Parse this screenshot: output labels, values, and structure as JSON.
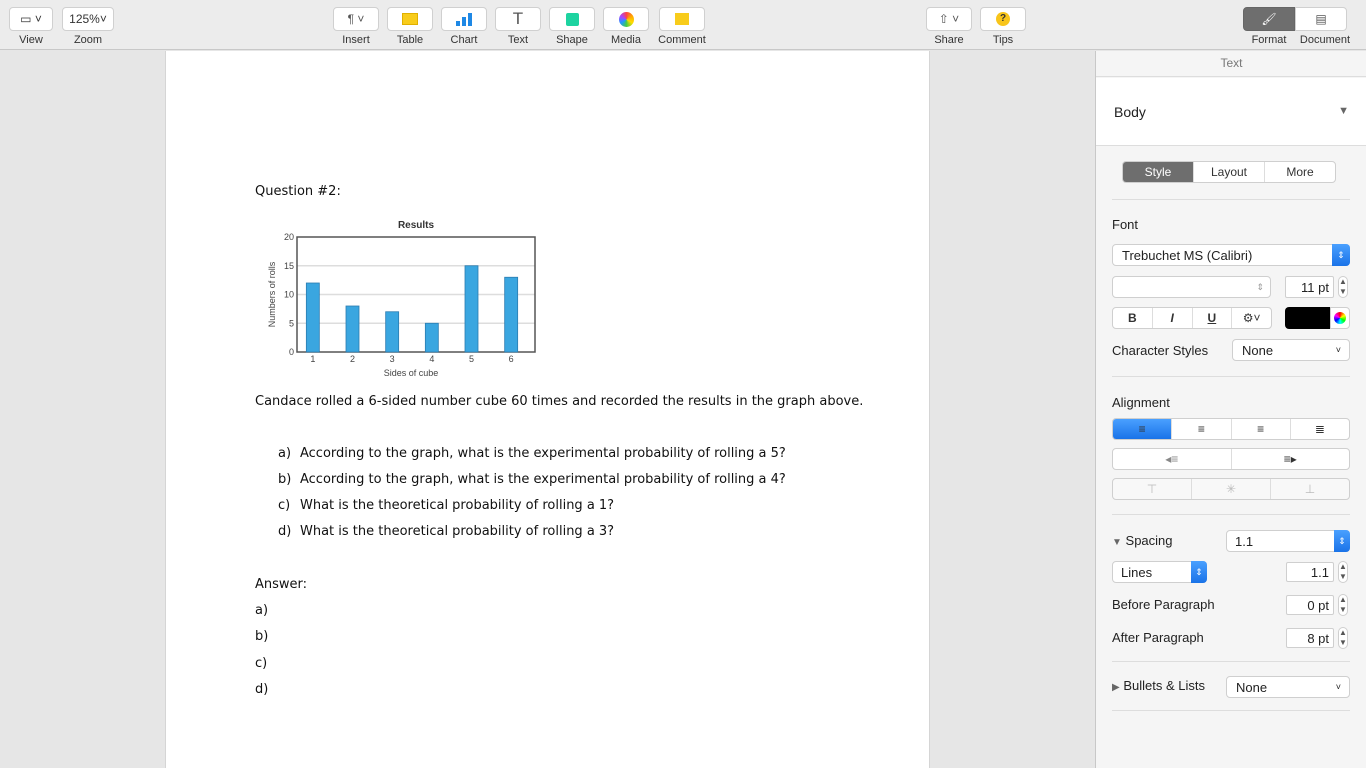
{
  "toolbar": {
    "view": "View",
    "zoom_value": "125%",
    "zoom": "Zoom",
    "insert": "Insert",
    "table": "Table",
    "chart": "Chart",
    "text": "Text",
    "shape": "Shape",
    "media": "Media",
    "comment": "Comment",
    "share": "Share",
    "tips": "Tips",
    "format": "Format",
    "document": "Document"
  },
  "document": {
    "question_title": "Question #2:",
    "description": "Candace rolled a 6-sided number cube 60 times and recorded the results in the graph above.",
    "questions": [
      {
        "letter": "a)",
        "text": "According to the graph, what is the experimental probability of rolling a 5?"
      },
      {
        "letter": "b)",
        "text": "According to the graph, what is the experimental probability of rolling a 4?"
      },
      {
        "letter": "c)",
        "text": "What is the theoretical probability of rolling a 1?"
      },
      {
        "letter": "d)",
        "text": "What is the theoretical probability of rolling a 3?"
      }
    ],
    "answer_label": "Answer:",
    "answers": [
      "a)",
      "b)",
      "c)",
      "d)"
    ]
  },
  "chart_data": {
    "type": "bar",
    "title": "Results",
    "xlabel": "Sides of cube",
    "ylabel": "Numbers of rolls",
    "categories": [
      "1",
      "2",
      "3",
      "4",
      "5",
      "6"
    ],
    "values": [
      12,
      8,
      7,
      5,
      15,
      13
    ],
    "ylim": [
      0,
      20
    ],
    "yticks": [
      "0",
      "5",
      "10",
      "15",
      "20"
    ],
    "grid": true,
    "bar_color": "#3aa6e0"
  },
  "sidebar": {
    "header": "Text",
    "paragraph_style": "Body",
    "tabs": [
      "Style",
      "Layout",
      "More"
    ],
    "font_label": "Font",
    "font_value": "Trebuchet MS (Calibri)",
    "font_size": "11 pt",
    "bold": "B",
    "italic": "I",
    "underline": "U",
    "text_color": "#000000",
    "char_styles_label": "Character Styles",
    "char_styles_value": "None",
    "alignment_label": "Alignment",
    "spacing_label": "Spacing",
    "spacing_value": "1.1",
    "lines_label": "Lines",
    "lines_value": "1.1",
    "before_label": "Before Paragraph",
    "before_value": "0 pt",
    "after_label": "After Paragraph",
    "after_value": "8 pt",
    "bullets_label": "Bullets & Lists",
    "bullets_value": "None",
    "accent": "#1a73e8"
  }
}
